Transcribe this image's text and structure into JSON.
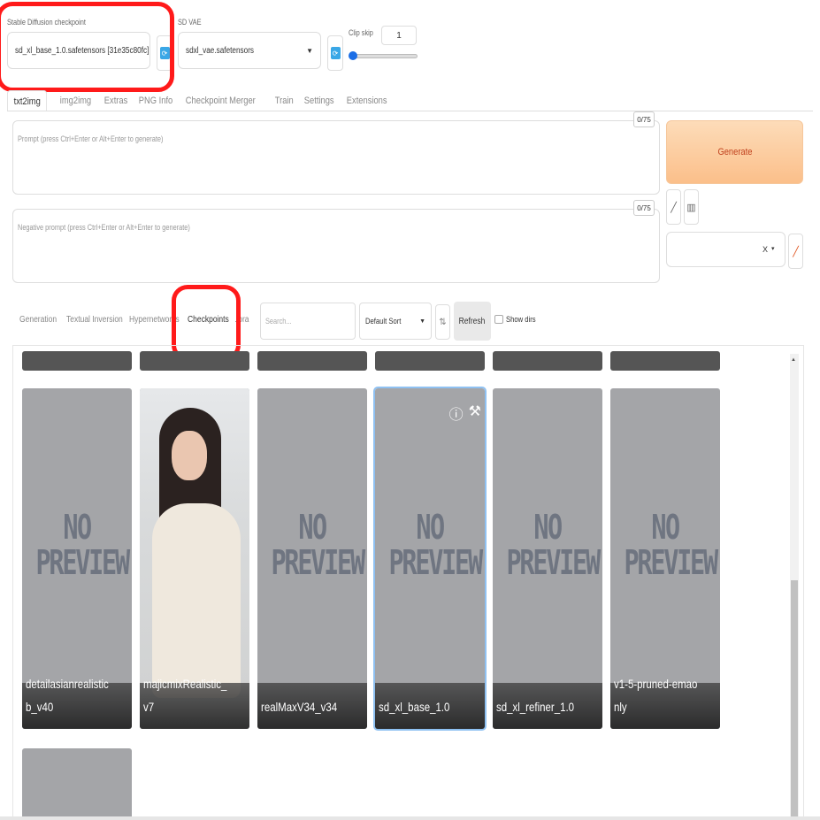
{
  "settings": {
    "checkpoint_label": "Stable Diffusion checkpoint",
    "checkpoint_value": "sd_xl_base_1.0.safetensors [31e35c80fc]",
    "vae_label": "SD VAE",
    "vae_value": "sdxl_vae.safetensors",
    "clip_skip_label": "Clip skip",
    "clip_skip_value": "1",
    "clip_skip_level": 0.0,
    "refresh_icon": "refresh-icon"
  },
  "tabs": [
    "txt2img",
    "img2img",
    "Extras",
    "PNG Info",
    "Checkpoint Merger",
    "Train",
    "Settings",
    "Extensions"
  ],
  "active_tab": "txt2img",
  "prompt": {
    "placeholder": "Prompt (press Ctrl+Enter or Alt+Enter to generate)",
    "counter": "0/75"
  },
  "negative_prompt": {
    "placeholder": "Negative prompt (press Ctrl+Enter or Alt+Enter to generate)",
    "counter": "0/75"
  },
  "generate_label": "Generate",
  "tools": {
    "pencil_icon": "pencil-icon",
    "trash_icon": "trash-icon",
    "styles_clear": "X",
    "styles_arrow": "▾",
    "edit_icon": "edit-icon"
  },
  "extra_networks": {
    "tabs": [
      "Generation",
      "Textual Inversion",
      "Hypernetworks",
      "Checkpoints",
      "Lora"
    ],
    "active_tab": "Checkpoints",
    "search_placeholder": "Search...",
    "sort_value": "Default Sort",
    "sort_dir_glyph": "⇅",
    "refresh_label": "Refresh",
    "show_dirs_label": "Show dirs"
  },
  "no_preview": [
    "NO",
    "PREVIEW"
  ],
  "card_icons": [
    "ⓘ",
    "⚒"
  ],
  "cards": [
    {
      "name": "detailasianrealisticb_v40",
      "preview": false
    },
    {
      "name": "majicmixRealistic_v7",
      "preview": true
    },
    {
      "name": "realMaxV34_v34",
      "preview": false
    },
    {
      "name": "sd_xl_base_1.0",
      "preview": false,
      "selected": true
    },
    {
      "name": "sd_xl_refiner_1.0",
      "preview": false
    },
    {
      "name": "v1-5-pruned-emaonly",
      "preview": false
    }
  ],
  "colors": {
    "highlight": "#ff1a1a",
    "generate_text": "#c0401c",
    "accent": "#1b6ee6"
  }
}
